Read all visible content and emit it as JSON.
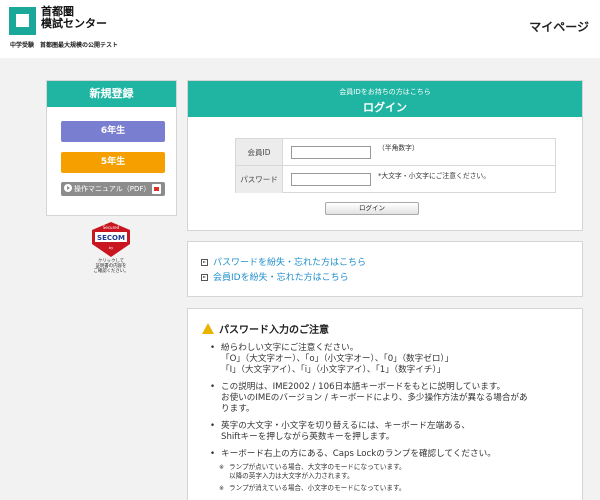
{
  "header": {
    "logo_line1": "首都圏",
    "logo_line2": "模試センター",
    "tagline": "中学受験　首都圏最大規模の公開テスト",
    "mypage": "マイページ"
  },
  "register": {
    "title": "新規登録",
    "grade6": "6年生",
    "grade5": "5年生",
    "manual": "操作マニュアル（PDF）"
  },
  "secom": {
    "line1": "Secured",
    "line2": "by",
    "brand": "SECOM",
    "caption1": "クリックして",
    "caption2": "証明書の内容を",
    "caption3": "ご確認ください。"
  },
  "login": {
    "subtitle": "会員IDをお持ちの方はこちら",
    "title": "ログイン",
    "id_label": "会員ID",
    "id_value": "",
    "id_note": "（半角数字）",
    "pw_label": "パスワード",
    "pw_value": "",
    "pw_note": "*大文字・小文字にご注意ください。",
    "button": "ログイン"
  },
  "links": {
    "forgot_password": "パスワードを紛失・忘れた方はこちら",
    "forgot_id": "会員IDを紛失・忘れた方はこちら"
  },
  "notes": {
    "title": "パスワード入力のご注意",
    "items": [
      {
        "lines": [
          "紛らわしい文字にご注意ください。",
          "「O」（大文字オー）、「o」（小文字オー）、「0」（数字ゼロ）」",
          "「I」（大文字アイ）、「i」（小文字アイ）、「1」（数字イチ）」"
        ]
      },
      {
        "lines": [
          "この説明は、IME2002 / 106日本語キーボードをもとに説明しています。",
          "お使いのIMEのバージョン / キーボードにより、多少操作方法が異なる場合があ",
          "ります。"
        ]
      },
      {
        "lines": [
          "英字の大文字・小文字を切り替えるには、キーボード左端ある、",
          "Shiftキーを押しながら英数キーを押します。"
        ]
      },
      {
        "lines": [
          "キーボード右上の方にある、Caps Lockのランプを確認してください。"
        ]
      }
    ],
    "sub1_line1": "ランプが点いている場合、大文字のモードになっています。",
    "sub1_line2": "以降の英字入力は大文字が入力されます。",
    "sub2_line1": "ランプが消えている場合、小文字のモードになっています。"
  }
}
